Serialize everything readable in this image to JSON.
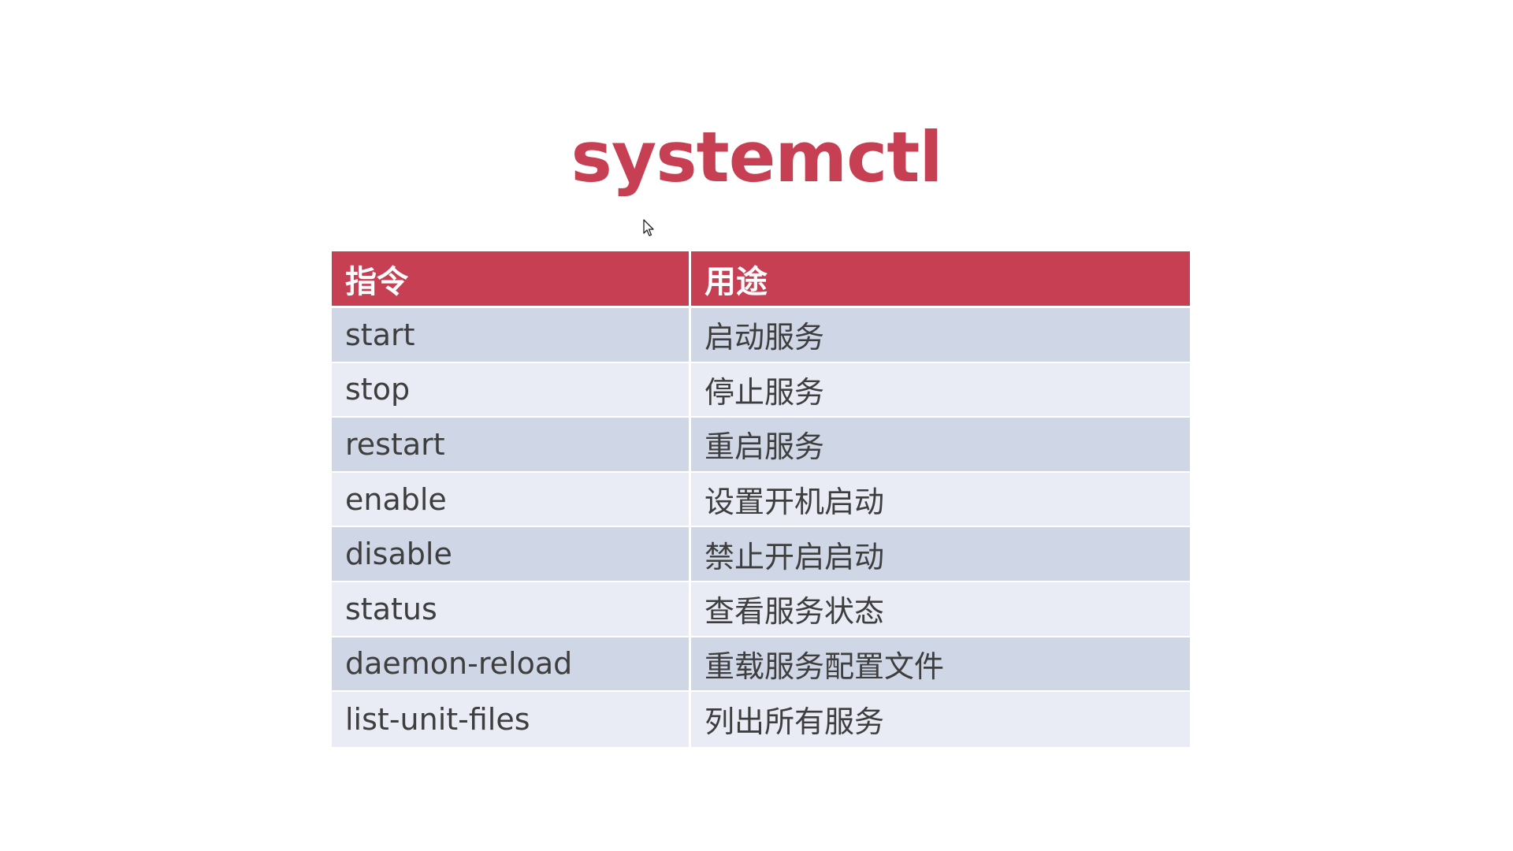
{
  "slide": {
    "title": "systemctl"
  },
  "table": {
    "headers": {
      "command": "指令",
      "purpose": "用途"
    },
    "rows": [
      {
        "command": "start",
        "purpose": "启动服务"
      },
      {
        "command": "stop",
        "purpose": "停止服务"
      },
      {
        "command": "restart",
        "purpose": "重启服务"
      },
      {
        "command": "enable",
        "purpose": "设置开机启动"
      },
      {
        "command": "disable",
        "purpose": "禁止开启启动"
      },
      {
        "command": "status",
        "purpose": "查看服务状态"
      },
      {
        "command": "daemon-reload",
        "purpose": "重载服务配置文件"
      },
      {
        "command": "list-unit-files",
        "purpose": "列出所有服务"
      }
    ]
  },
  "colors": {
    "accent": "#c63f53",
    "row_dark": "#cfd7e6",
    "row_light": "#e9ecf5",
    "text": "#3e3e3e"
  },
  "icons": {
    "cursor": "mouse-pointer-icon"
  }
}
